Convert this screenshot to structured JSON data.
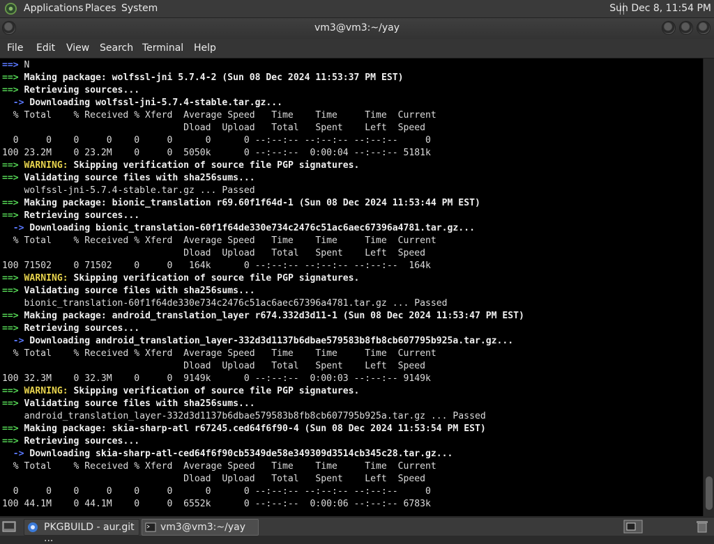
{
  "top_panel": {
    "menus": [
      "Applications",
      "Places",
      "System"
    ],
    "clock": "Sun Dec  8, 11:54 PM"
  },
  "window": {
    "title": "vm3@vm3:~/yay",
    "menus": [
      "File",
      "Edit",
      "View",
      "Search",
      "Terminal",
      "Help"
    ]
  },
  "terminal": {
    "lines": [
      {
        "p": "arrow-b",
        "t": [
          [
            "",
            "==> N"
          ]
        ]
      },
      {
        "p": "arrow-g",
        "t": [
          [
            "b",
            "Making package: wolfssl-jni 5.7.4-2 (Sun 08 Dec 2024 11:53:37 PM EST)"
          ]
        ]
      },
      {
        "p": "arrow-g",
        "t": [
          [
            "b",
            "Retrieving sources..."
          ]
        ]
      },
      {
        "p": "sub",
        "t": [
          [
            "b",
            "Downloading wolfssl-jni-5.7.4-stable.tar.gz..."
          ]
        ]
      },
      {
        "p": "",
        "t": [
          [
            "",
            "  % Total    % Received % Xferd  Average Speed   Time    Time     Time  Current"
          ]
        ]
      },
      {
        "p": "",
        "t": [
          [
            "",
            "                                 Dload  Upload   Total   Spent    Left  Speed"
          ]
        ]
      },
      {
        "p": "",
        "t": [
          [
            "",
            "  0     0    0     0    0     0      0      0 --:--:-- --:--:-- --:--:--     0"
          ]
        ]
      },
      {
        "p": "",
        "t": [
          [
            "",
            "100 23.2M    0 23.2M    0     0  5050k      0 --:--:--  0:00:04 --:--:-- 5181k"
          ]
        ]
      },
      {
        "p": "arrow-g",
        "t": [
          [
            "warn",
            "WARNING:"
          ],
          [
            "b",
            " Skipping verification of source file PGP signatures."
          ]
        ]
      },
      {
        "p": "arrow-g",
        "t": [
          [
            "b",
            "Validating source files with sha256sums..."
          ]
        ]
      },
      {
        "p": "",
        "t": [
          [
            "",
            "    wolfssl-jni-5.7.4-stable.tar.gz ... Passed"
          ]
        ]
      },
      {
        "p": "arrow-g",
        "t": [
          [
            "b",
            "Making package: bionic_translation r69.60f1f64d-1 (Sun 08 Dec 2024 11:53:44 PM EST)"
          ]
        ]
      },
      {
        "p": "arrow-g",
        "t": [
          [
            "b",
            "Retrieving sources..."
          ]
        ]
      },
      {
        "p": "sub",
        "t": [
          [
            "b",
            "Downloading bionic_translation-60f1f64de330e734c2476c51ac6aec67396a4781.tar.gz..."
          ]
        ]
      },
      {
        "p": "",
        "t": [
          [
            "",
            "  % Total    % Received % Xferd  Average Speed   Time    Time     Time  Current"
          ]
        ]
      },
      {
        "p": "",
        "t": [
          [
            "",
            "                                 Dload  Upload   Total   Spent    Left  Speed"
          ]
        ]
      },
      {
        "p": "",
        "t": [
          [
            "",
            "100 71502    0 71502    0     0   164k      0 --:--:-- --:--:-- --:--:--  164k"
          ]
        ]
      },
      {
        "p": "arrow-g",
        "t": [
          [
            "warn",
            "WARNING:"
          ],
          [
            "b",
            " Skipping verification of source file PGP signatures."
          ]
        ]
      },
      {
        "p": "arrow-g",
        "t": [
          [
            "b",
            "Validating source files with sha256sums..."
          ]
        ]
      },
      {
        "p": "",
        "t": [
          [
            "",
            "    bionic_translation-60f1f64de330e734c2476c51ac6aec67396a4781.tar.gz ... Passed"
          ]
        ]
      },
      {
        "p": "arrow-g",
        "t": [
          [
            "b",
            "Making package: android_translation_layer r674.332d3d11-1 (Sun 08 Dec 2024 11:53:47 PM EST)"
          ]
        ]
      },
      {
        "p": "arrow-g",
        "t": [
          [
            "b",
            "Retrieving sources..."
          ]
        ]
      },
      {
        "p": "sub",
        "t": [
          [
            "b",
            "Downloading android_translation_layer-332d3d1137b6dbae579583b8fb8cb607795b925a.tar.gz..."
          ]
        ]
      },
      {
        "p": "",
        "t": [
          [
            "",
            "  % Total    % Received % Xferd  Average Speed   Time    Time     Time  Current"
          ]
        ]
      },
      {
        "p": "",
        "t": [
          [
            "",
            "                                 Dload  Upload   Total   Spent    Left  Speed"
          ]
        ]
      },
      {
        "p": "",
        "t": [
          [
            "",
            "100 32.3M    0 32.3M    0     0  9149k      0 --:--:--  0:00:03 --:--:-- 9149k"
          ]
        ]
      },
      {
        "p": "arrow-g",
        "t": [
          [
            "warn",
            "WARNING:"
          ],
          [
            "b",
            " Skipping verification of source file PGP signatures."
          ]
        ]
      },
      {
        "p": "arrow-g",
        "t": [
          [
            "b",
            "Validating source files with sha256sums..."
          ]
        ]
      },
      {
        "p": "",
        "t": [
          [
            "",
            "    android_translation_layer-332d3d1137b6dbae579583b8fb8cb607795b925a.tar.gz ... Passed"
          ]
        ]
      },
      {
        "p": "arrow-g",
        "t": [
          [
            "b",
            "Making package: skia-sharp-atl r67245.ced64f6f90-4 (Sun 08 Dec 2024 11:53:54 PM EST)"
          ]
        ]
      },
      {
        "p": "arrow-g",
        "t": [
          [
            "b",
            "Retrieving sources..."
          ]
        ]
      },
      {
        "p": "sub",
        "t": [
          [
            "b",
            "Downloading skia-sharp-atl-ced64f6f90cb5349de58e349309d3514cb345c28.tar.gz..."
          ]
        ]
      },
      {
        "p": "",
        "t": [
          [
            "",
            "  % Total    % Received % Xferd  Average Speed   Time    Time     Time  Current"
          ]
        ]
      },
      {
        "p": "",
        "t": [
          [
            "",
            "                                 Dload  Upload   Total   Spent    Left  Speed"
          ]
        ]
      },
      {
        "p": "",
        "t": [
          [
            "",
            "  0     0    0     0    0     0      0      0 --:--:-- --:--:-- --:--:--     0"
          ]
        ]
      },
      {
        "p": "",
        "t": [
          [
            "",
            "100 44.1M    0 44.1M    0     0  6552k      0 --:--:--  0:00:06 --:--:-- 6783k"
          ]
        ]
      }
    ]
  },
  "taskbar": {
    "tasks": [
      {
        "label": "PKGBUILD - aur.git ..."
      },
      {
        "label": "vm3@vm3:~/yay"
      }
    ]
  }
}
